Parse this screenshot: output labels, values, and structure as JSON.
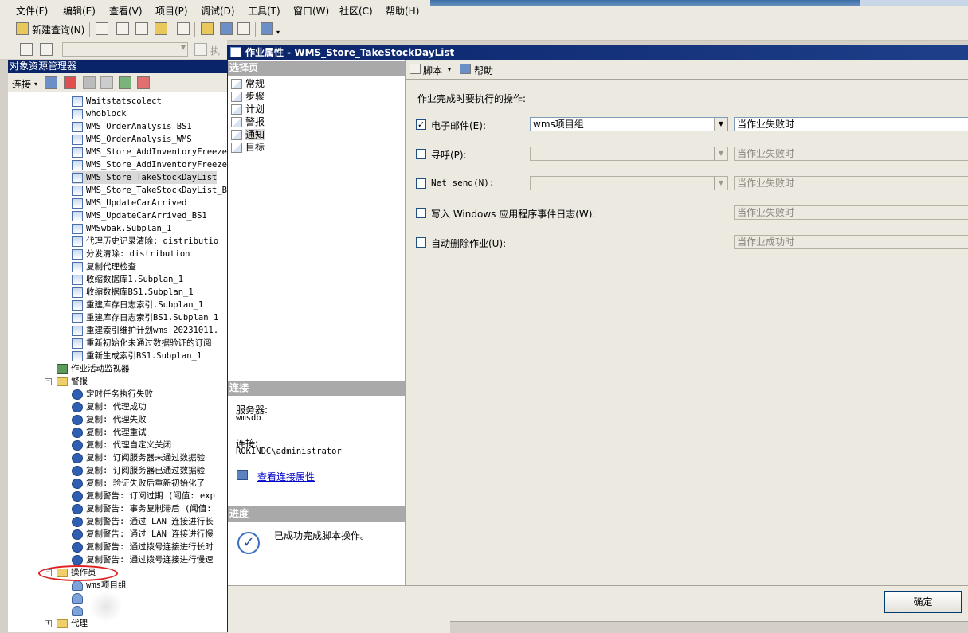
{
  "menubar": {
    "items": [
      "文件(F)",
      "编辑(E)",
      "查看(V)",
      "项目(P)",
      "调试(D)",
      "工具(T)",
      "窗口(W)",
      "社区(C)",
      "帮助(H)"
    ]
  },
  "toolbar": {
    "new_query": "新建查询(N)",
    "execute_partial": "执"
  },
  "object_explorer": {
    "title": "对象资源管理器",
    "connect_label": "连接",
    "jobs": [
      "Waitstatscolect",
      "whoblock",
      "WMS_OrderAnalysis_BS1",
      "WMS_OrderAnalysis_WMS",
      "WMS_Store_AddInventoryFreezeI",
      "WMS_Store_AddInventoryFreezeI",
      "WMS_Store_TakeStockDayList",
      "WMS_Store_TakeStockDayList_BS",
      "WMS_UpdateCarArrived",
      "WMS_UpdateCarArrived_BS1",
      "WMSwbak.Subplan_1",
      "代理历史记录清除: distributio",
      "分发清除: distribution",
      "复制代理检查",
      "收缩数据库1.Subplan_1",
      "收缩数据库BS1.Subplan_1",
      "重建库存日志索引.Subplan_1",
      "重建库存日志索引BS1.Subplan_1",
      "重建索引维护计划wms 20231011.",
      "重新初始化未通过数据验证的订阅",
      "重新生成索引BS1.Subplan_1"
    ],
    "job_monitor": "作业活动监视器",
    "alerts_folder": "警报",
    "alerts": [
      "定时任务执行失败",
      "复制: 代理成功",
      "复制: 代理失败",
      "复制: 代理重试",
      "复制: 代理自定义关闭",
      "复制: 订阅服务器未通过数据验",
      "复制: 订阅服务器已通过数据验",
      "复制: 验证失败后重新初始化了",
      "复制警告: 订阅过期 (阈值: exp",
      "复制警告: 事务复制滞后 (阈值:",
      "复制警告: 通过 LAN 连接进行长",
      "复制警告: 通过 LAN 连接进行慢",
      "复制警告: 通过拨号连接进行长时",
      "复制警告: 通过拨号连接进行慢速"
    ],
    "operators_folder": "操作员",
    "operators": [
      "wms项目组"
    ],
    "agent_folder": "代理"
  },
  "dialog": {
    "title": "作业属性 - WMS_Store_TakeStockDayList",
    "select_page_header": "选择页",
    "pages": [
      "常规",
      "步骤",
      "计划",
      "警报",
      "通知",
      "目标"
    ],
    "connection_header": "连接",
    "server_label": "服务器:",
    "server_value": "wmsdb",
    "connection_label": "连接:",
    "connection_value": "ROKINDC\\administrator",
    "view_connection": "查看连接属性",
    "progress_header": "进度",
    "progress_text": "已成功完成脚本操作。",
    "script_label": "脚本",
    "help_label": "帮助",
    "section_label": "作业完成时要执行的操作:",
    "rows": {
      "email": {
        "label": "电子邮件(E):",
        "checked": true,
        "combo": "wms项目组",
        "when": "当作业失败时"
      },
      "page": {
        "label": "寻呼(P):",
        "checked": false,
        "combo": "",
        "when": "当作业失败时"
      },
      "netsend": {
        "label": "Net send(N):",
        "checked": false,
        "combo": "",
        "when": "当作业失败时"
      },
      "eventlog": {
        "label": "写入 Windows 应用程序事件日志(W):",
        "checked": false,
        "when": "当作业失败时"
      },
      "autodelete": {
        "label": "自动删除作业(U):",
        "checked": false,
        "when": "当作业成功时"
      }
    },
    "ok_button": "确定"
  }
}
